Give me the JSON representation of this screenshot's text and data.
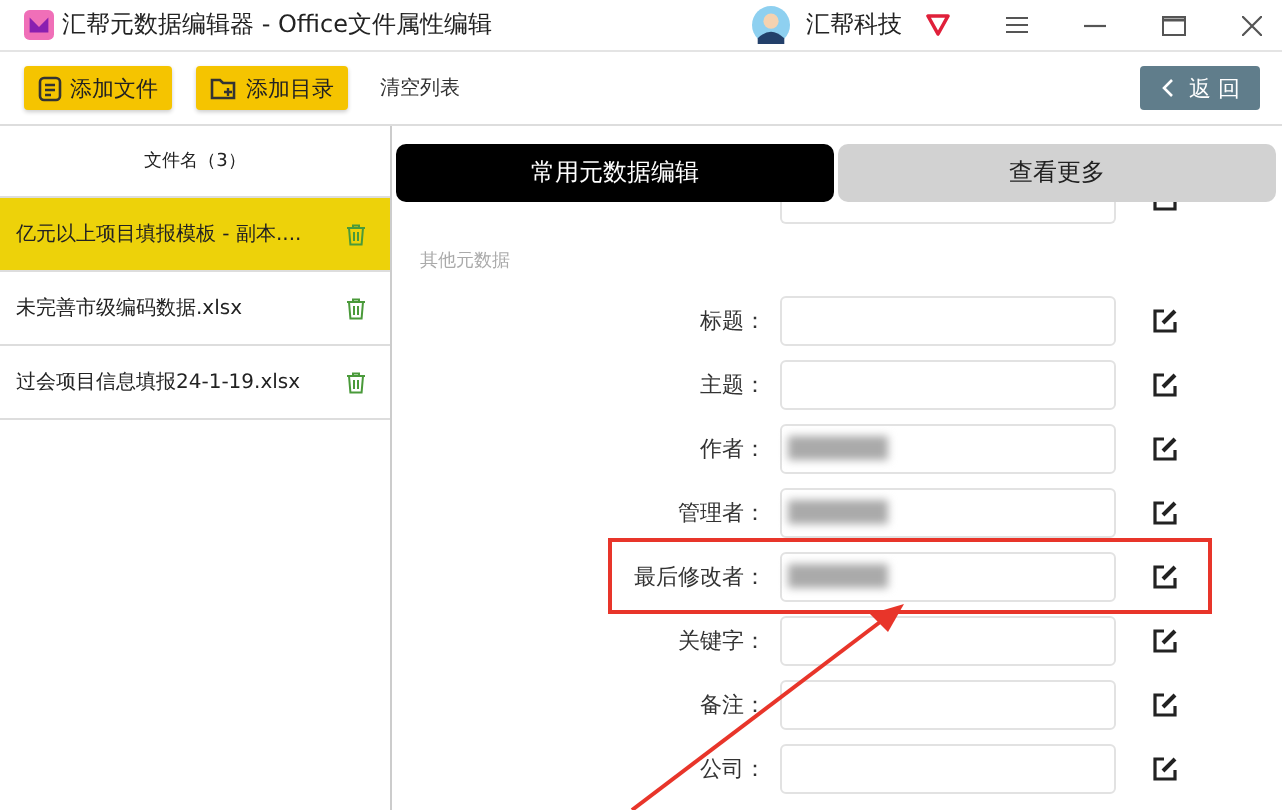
{
  "window": {
    "title": "汇帮元数据编辑器 - Office文件属性编辑",
    "user": "汇帮科技"
  },
  "toolbar": {
    "buttons": [
      {
        "label": "添加文件",
        "kind": "file"
      },
      {
        "label": "添加目录",
        "kind": "folder"
      },
      {
        "label": "清空列表",
        "kind": "plain"
      }
    ],
    "back": "返 回"
  },
  "file_list": {
    "header": "文件名（3）",
    "files": [
      {
        "name": "亿元以上项目填报模板 - 副本....",
        "selected": true
      },
      {
        "name": "未完善市级编码数据.xlsx",
        "selected": false
      },
      {
        "name": "过会项目信息填报24-1-19.xlsx",
        "selected": false
      }
    ]
  },
  "tabs": [
    {
      "label": "常用元数据编辑",
      "selected": true
    },
    {
      "label": "查看更多",
      "selected": false
    }
  ],
  "section": "其他元数据",
  "fields": [
    {
      "label": "标题：",
      "blurred": false,
      "highlighted": false
    },
    {
      "label": "主题：",
      "blurred": false,
      "highlighted": false
    },
    {
      "label": "作者：",
      "blurred": true,
      "highlighted": false
    },
    {
      "label": "管理者：",
      "blurred": true,
      "highlighted": false
    },
    {
      "label": "最后修改者：",
      "blurred": true,
      "highlighted": true
    },
    {
      "label": "关键字：",
      "blurred": false,
      "highlighted": false
    },
    {
      "label": "备注：",
      "blurred": false,
      "highlighted": false
    },
    {
      "label": "公司：",
      "blurred": false,
      "highlighted": false
    }
  ]
}
